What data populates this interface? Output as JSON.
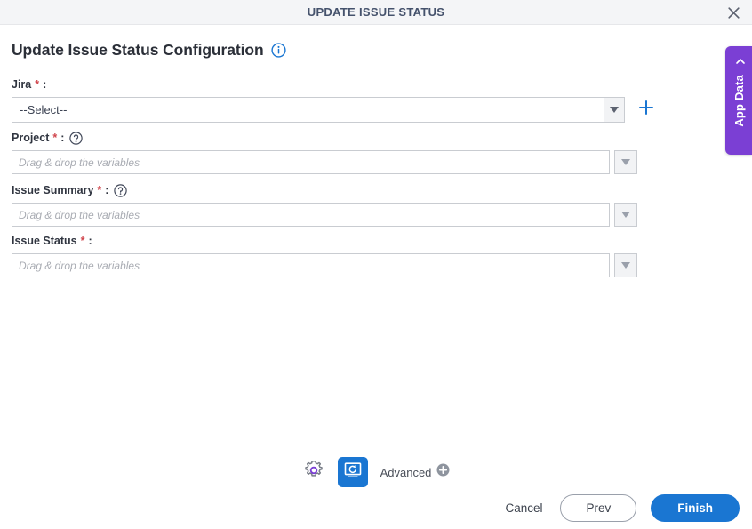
{
  "window": {
    "title": "UPDATE ISSUE STATUS",
    "close_icon": "close-icon"
  },
  "page": {
    "title": "Update Issue Status Configuration",
    "info_icon": "info-icon"
  },
  "form": {
    "fields": [
      {
        "label": "Jira",
        "required_mark": "*",
        "colon": ":",
        "has_help": false,
        "control": "select",
        "value": "--Select--",
        "has_add_button": true,
        "add_icon": "plus-icon",
        "arrow_icon": "caret-down-icon"
      },
      {
        "label": "Project",
        "required_mark": "*",
        "colon": ":",
        "has_help": true,
        "help_icon": "help-circle-icon",
        "control": "variable-input",
        "value": "",
        "placeholder": "Drag & drop the variables",
        "arrow_icon": "caret-down-icon"
      },
      {
        "label": "Issue Summary",
        "required_mark": "*",
        "colon": ":",
        "has_help": true,
        "help_icon": "help-circle-icon",
        "control": "variable-input",
        "value": "",
        "placeholder": "Drag & drop the variables",
        "arrow_icon": "caret-down-icon"
      },
      {
        "label": "Issue Status",
        "required_mark": "*",
        "colon": ":",
        "has_help": false,
        "control": "variable-input",
        "value": "",
        "placeholder": "Drag & drop the variables",
        "arrow_icon": "caret-down-icon"
      }
    ]
  },
  "side_tab": {
    "label": "App Data",
    "chevron_icon": "chevron-left-icon",
    "color": "#7b3fd4"
  },
  "toolbar": {
    "gear_icon": "gear-icon",
    "screen_icon": "screen-refresh-icon",
    "advanced_label": "Advanced",
    "advanced_add_icon": "plus-circle-icon"
  },
  "footer": {
    "cancel_label": "Cancel",
    "prev_label": "Prev",
    "finish_label": "Finish"
  },
  "colors": {
    "accent_blue": "#1a76d2",
    "purple": "#7b3fd4",
    "required_red": "#d0454c",
    "title_gray": "#45526c"
  }
}
